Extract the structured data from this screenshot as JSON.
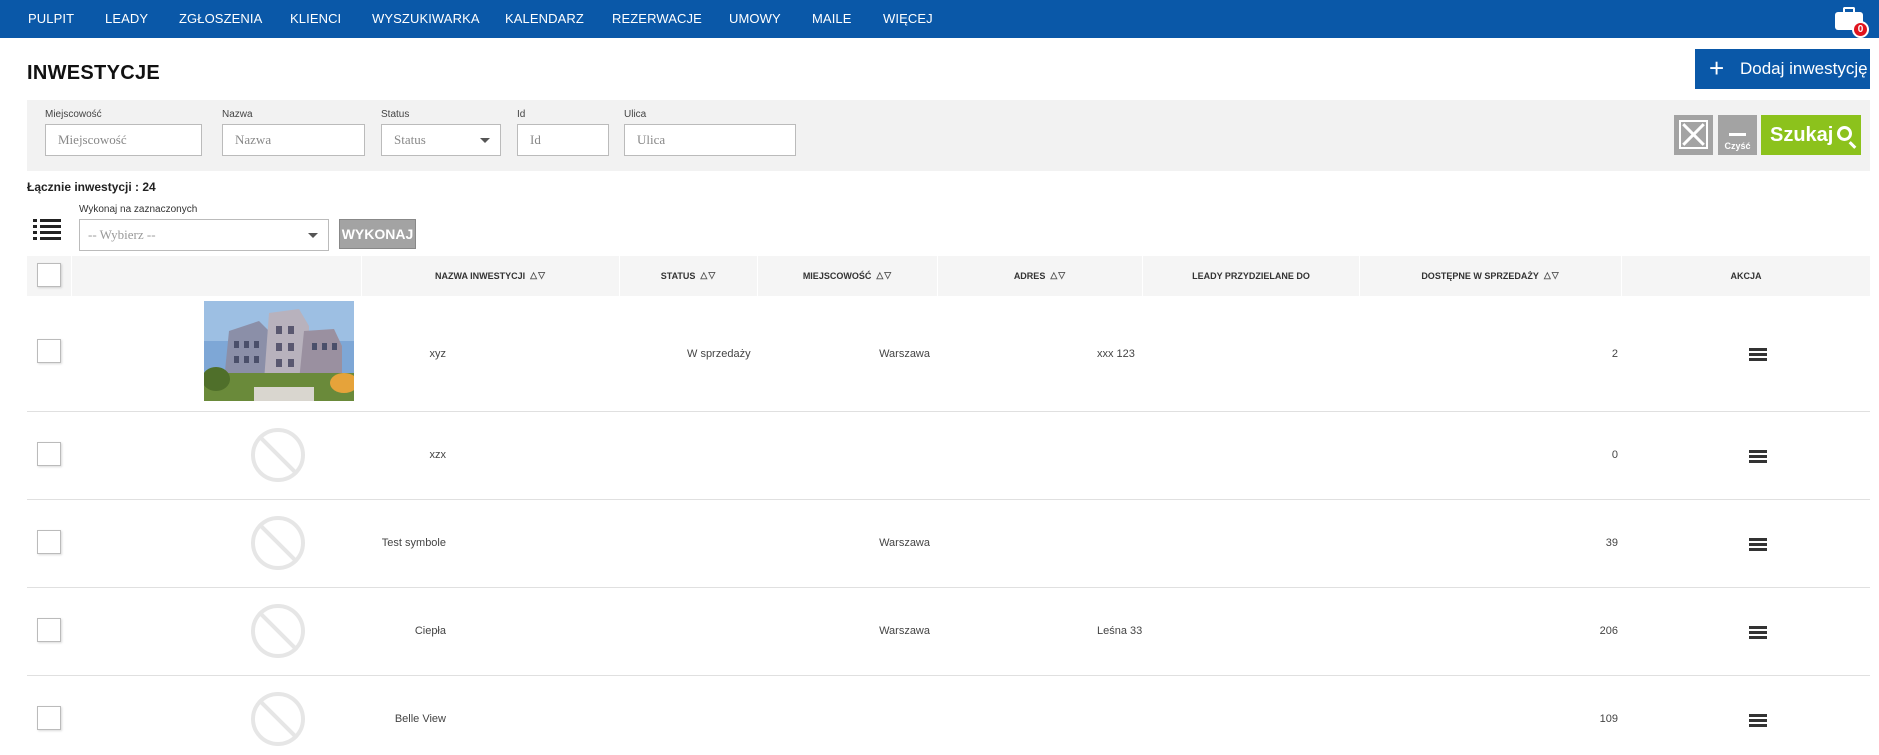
{
  "nav": {
    "items": [
      "PULPIT",
      "LEADY",
      "ZGŁOSZENIA",
      "KLIENCI",
      "WYSZUKIWARKA",
      "KALENDARZ",
      "REZERWACJE",
      "UMOWY",
      "MAILE",
      "WIĘCEJ"
    ],
    "notifications_count": "0"
  },
  "header": {
    "title": "INWESTYCJE",
    "add_button": "Dodaj inwestycję"
  },
  "filters": {
    "city_label": "Miejscowość",
    "city_placeholder": "Miejscowość",
    "name_label": "Nazwa",
    "name_placeholder": "Nazwa",
    "status_label": "Status",
    "status_value": "Status",
    "id_label": "Id",
    "id_placeholder": "Id",
    "street_label": "Ulica",
    "street_placeholder": "Ulica",
    "clear_all_label": "Czyść",
    "search_label": "Szukaj"
  },
  "summary": {
    "total_text": "Łącznie inwestycji : 24"
  },
  "bulk": {
    "label": "Wykonaj na zaznaczonych",
    "select_value": "-- Wybierz --",
    "execute_label": "WYKONAJ"
  },
  "table": {
    "headers": {
      "name": "NAZWA INWESTYCJI",
      "status": "STATUS",
      "city": "MIEJSCOWOŚĆ",
      "address": "ADRES",
      "leads": "LEADY PRZYDZIELANE DO",
      "available": "DOSTĘPNE W SPRZEDAŻY",
      "action": "AKCJA"
    },
    "rows": [
      {
        "name": "xyz",
        "status": "W sprzedaży",
        "city": "Warszawa",
        "address": "xxx 123",
        "available": "2",
        "has_image": true
      },
      {
        "name": "xzx",
        "status": "",
        "city": "",
        "address": "",
        "available": "0",
        "has_image": false
      },
      {
        "name": "Test symbole",
        "status": "",
        "city": "Warszawa",
        "address": "",
        "available": "39",
        "has_image": false
      },
      {
        "name": "Ciepła",
        "status": "",
        "city": "Warszawa",
        "address": "Leśna 33",
        "available": "206",
        "has_image": false
      },
      {
        "name": "Belle View",
        "status": "",
        "city": "",
        "address": "",
        "available": "109",
        "has_image": false
      }
    ]
  },
  "colors": {
    "nav_bg": "#0a58a8",
    "search_btn": "#8cc21c",
    "gray_btn": "#a3a3a3"
  }
}
